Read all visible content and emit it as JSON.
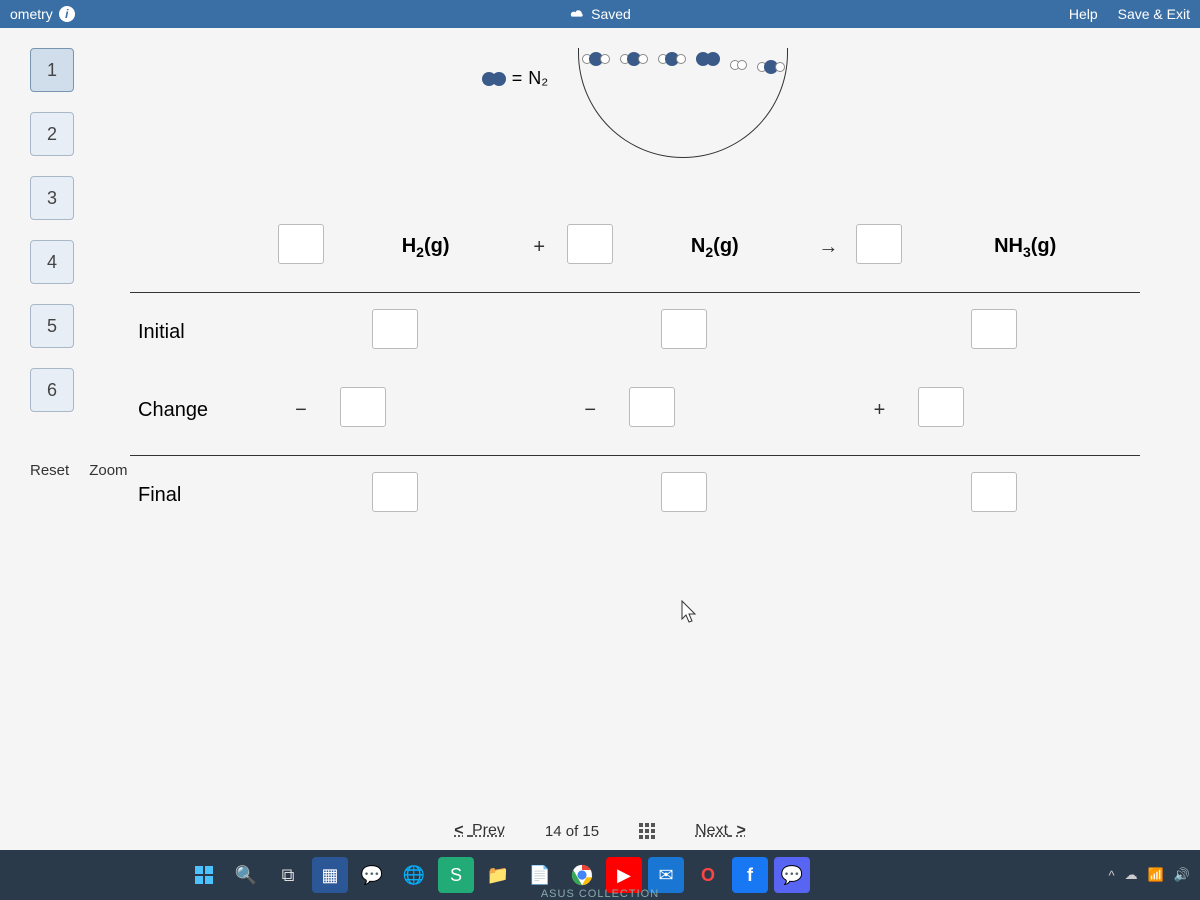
{
  "topbar": {
    "title_fragment": "ometry",
    "saved_label": "Saved",
    "help_label": "Help",
    "save_exit_label": "Save & Exit"
  },
  "sidebar": {
    "steps": [
      "1",
      "2",
      "3",
      "4",
      "5",
      "6"
    ],
    "active_step": 0,
    "reset_label": "Reset",
    "zoom_label": "Zoom"
  },
  "legend": {
    "equals": "=",
    "n2_label": "N₂"
  },
  "equation": {
    "species": [
      {
        "formula_html": "H<sub>2</sub>(g)"
      },
      {
        "formula_html": "N<sub>2</sub>(g)"
      },
      {
        "formula_html": "NH<sub>3</sub>(g)"
      }
    ],
    "op_plus": "+",
    "op_arrow": "→",
    "rows": {
      "initial": "Initial",
      "change": "Change",
      "final": "Final"
    },
    "change_signs": [
      "−",
      "−",
      "+"
    ]
  },
  "nav": {
    "prev": "Prev",
    "next": "Next",
    "count": "14 of 15"
  },
  "taskbar": {
    "label": "ASUS COLLECTION",
    "icons": [
      "windows",
      "search",
      "task-view",
      "widgets",
      "chat",
      "edge",
      "store",
      "file-explorer",
      "office",
      "chrome",
      "youtube",
      "mail",
      "opera",
      "facebook",
      "discord"
    ]
  }
}
